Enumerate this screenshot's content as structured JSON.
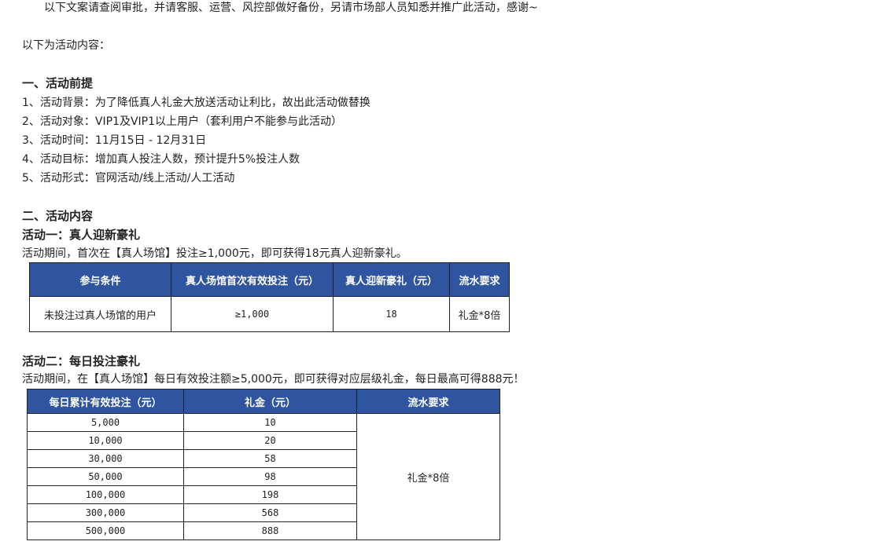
{
  "intro": "以下文案请查阅审批，并请客服、运营、风控部做好备份，另请市场部人员知悉并推广此活动，感谢~",
  "content_label": "以下为活动内容：",
  "section1": {
    "title": "一、活动前提",
    "items": [
      "1、活动背景：为了降低真人礼金大放送活动让利比，故出此活动做替换",
      "2、活动对象：VIP1及VIP1以上用户（套利用户不能参与此活动）",
      "3、活动时间：11月15日 - 12月31日",
      "4、活动目标：增加真人投注人数，预计提升5%投注人数",
      "5、活动形式：官网活动/线上活动/人工活动"
    ]
  },
  "section2": {
    "title": "二、活动内容",
    "activity1": {
      "title": "活动一：真人迎新豪礼",
      "desc": "活动期间，首次在【真人场馆】投注≥1,000元，即可获得18元真人迎新豪礼。",
      "headers": [
        "参与条件",
        "真人场馆首次有效投注（元）",
        "真人迎新豪礼（元）",
        "流水要求"
      ],
      "row": [
        "未投注过真人场馆的用户",
        "≥1,000",
        "18",
        "礼金*8倍"
      ]
    },
    "activity2": {
      "title": "活动二：每日投注豪礼",
      "desc": "活动期间，在【真人场馆】每日有效投注额≥5,000元，即可获得对应层级礼金，每日最高可得888元！",
      "headers": [
        "每日累计有效投注（元）",
        "礼金（元）",
        "流水要求"
      ],
      "rows": [
        [
          "5,000",
          "10"
        ],
        [
          "10,000",
          "20"
        ],
        [
          "30,000",
          "58"
        ],
        [
          "50,000",
          "98"
        ],
        [
          "100,000",
          "198"
        ],
        [
          "300,000",
          "568"
        ],
        [
          "500,000",
          "888"
        ]
      ],
      "turnover": "礼金*8倍"
    }
  },
  "colors": {
    "header_bg": "#2f55a0",
    "header_text": "#ffffff"
  }
}
